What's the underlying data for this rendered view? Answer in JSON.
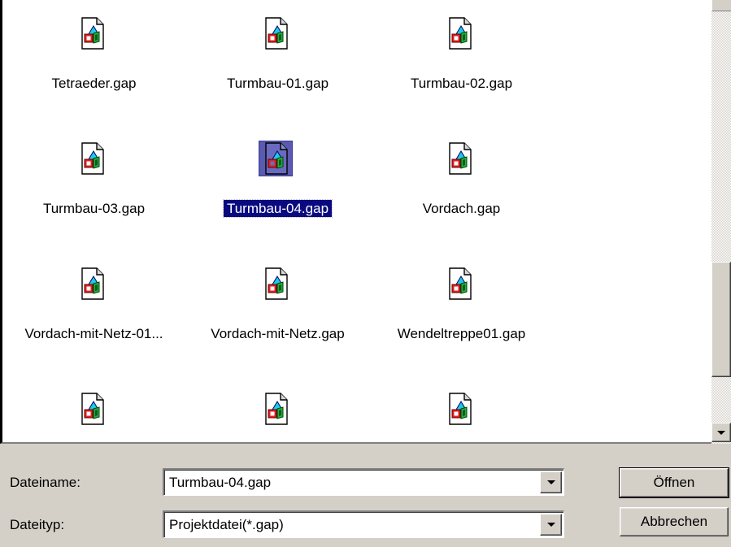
{
  "file_list": {
    "items": [
      {
        "name": "Tetraeder.gap",
        "selected": false
      },
      {
        "name": "Turmbau-01.gap",
        "selected": false
      },
      {
        "name": "Turmbau-02.gap",
        "selected": false
      },
      {
        "name": "Turmbau-03.gap",
        "selected": false
      },
      {
        "name": "Turmbau-04.gap",
        "selected": true
      },
      {
        "name": "Vordach.gap",
        "selected": false
      },
      {
        "name": "Vordach-mit-Netz-01...",
        "selected": false
      },
      {
        "name": "Vordach-mit-Netz.gap",
        "selected": false
      },
      {
        "name": "Wendeltreppe01.gap",
        "selected": false
      },
      {
        "name": "",
        "selected": false
      },
      {
        "name": "",
        "selected": false
      },
      {
        "name": "",
        "selected": false
      }
    ]
  },
  "filename": {
    "label": "Dateiname:",
    "value": "Turmbau-04.gap"
  },
  "filetype": {
    "label": "Dateityp:",
    "value": "Projektdatei(*.gap)"
  },
  "buttons": {
    "open_label": "Öffnen",
    "cancel_label": "Abbrechen"
  },
  "icons": {
    "file_icon": "gap-project-file-icon",
    "dropdown_icon": "chevron-down-icon"
  },
  "colors": {
    "selection": "#0a0a80",
    "dialog_face": "#d4d0c8"
  }
}
